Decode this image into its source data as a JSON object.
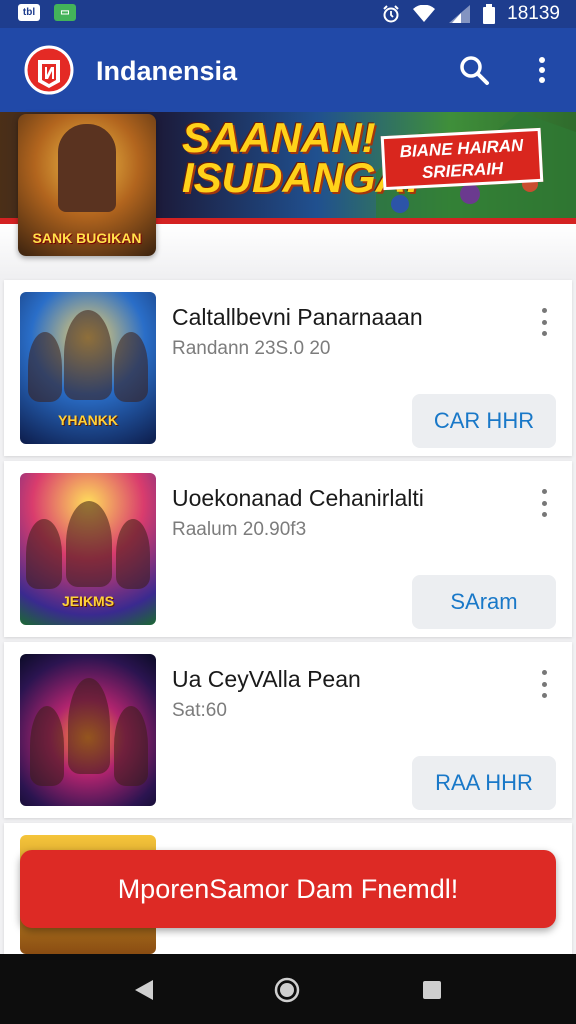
{
  "status_bar": {
    "left_icons": [
      "tbl",
      "img"
    ],
    "time": "18139",
    "icons": [
      "alarm-icon",
      "wifi-icon",
      "signal-icon",
      "battery-icon"
    ]
  },
  "app_bar": {
    "title": "Indanensia",
    "logo_icon": "app-logo-icon",
    "search_icon": "search-icon",
    "menu_icon": "more-vert-icon"
  },
  "banner": {
    "hero_logo": "SANK BUGIKAN",
    "headline": "SAANAN!\nISUDANGA!",
    "tag": "BIANE HAIRAN\nSRIERAIH"
  },
  "games": [
    {
      "title": "Caltallbevni Panarnaaan",
      "subtitle": "Randann 23S.0 20",
      "action": "CAR HHR",
      "thumb_text": "YHANKK"
    },
    {
      "title": "Uoekonanad Cehanirlalti",
      "subtitle": "Raalum 20.90f3",
      "action": "SAram",
      "thumb_text": "JEIKMS"
    },
    {
      "title": "Ua CeyVAlla Pean",
      "subtitle": "Sat:60",
      "action": "RAA HHR",
      "thumb_text": ""
    }
  ],
  "cta": {
    "label": "MporenSamor Dam Fnemdl!"
  },
  "nav_bar": {
    "back_icon": "back-icon",
    "home_icon": "home-icon",
    "recents_icon": "recents-icon"
  },
  "colors": {
    "app_bar": "#2149a8",
    "status_bar": "#1e3d8e",
    "cta": "#dd2a25",
    "action_text": "#1978c8"
  }
}
